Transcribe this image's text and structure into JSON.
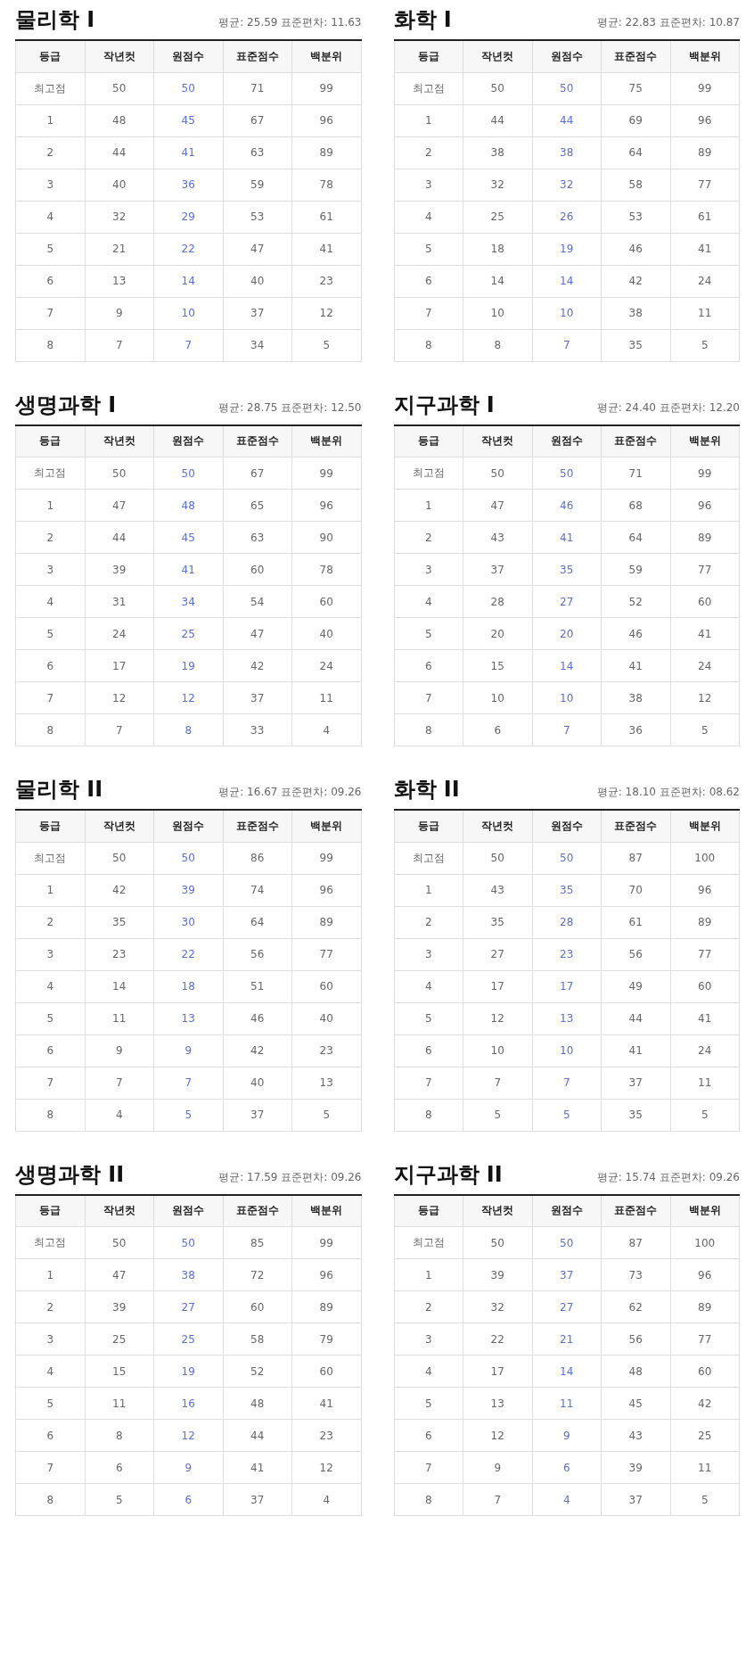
{
  "subjects": [
    {
      "title": "물리학 I",
      "stats": "평균: 25.59 표준편차: 11.63",
      "columns": [
        "등급",
        "작년컷",
        "원점수",
        "표준점수",
        "백분위"
      ],
      "rows": [
        [
          "최고점",
          "50",
          "50",
          "71",
          "99"
        ],
        [
          "1",
          "48",
          "45",
          "67",
          "96"
        ],
        [
          "2",
          "44",
          "41",
          "63",
          "89"
        ],
        [
          "3",
          "40",
          "36",
          "59",
          "78"
        ],
        [
          "4",
          "32",
          "29",
          "53",
          "61"
        ],
        [
          "5",
          "21",
          "22",
          "47",
          "41"
        ],
        [
          "6",
          "13",
          "14",
          "40",
          "23"
        ],
        [
          "7",
          "9",
          "10",
          "37",
          "12"
        ],
        [
          "8",
          "7",
          "7",
          "34",
          "5"
        ]
      ]
    },
    {
      "title": "화학 I",
      "stats": "평균: 22.83 표준편차: 10.87",
      "columns": [
        "등급",
        "작년컷",
        "원점수",
        "표준점수",
        "백분위"
      ],
      "rows": [
        [
          "최고점",
          "50",
          "50",
          "75",
          "99"
        ],
        [
          "1",
          "44",
          "44",
          "69",
          "96"
        ],
        [
          "2",
          "38",
          "38",
          "64",
          "89"
        ],
        [
          "3",
          "32",
          "32",
          "58",
          "77"
        ],
        [
          "4",
          "25",
          "26",
          "53",
          "61"
        ],
        [
          "5",
          "18",
          "19",
          "46",
          "41"
        ],
        [
          "6",
          "14",
          "14",
          "42",
          "24"
        ],
        [
          "7",
          "10",
          "10",
          "38",
          "11"
        ],
        [
          "8",
          "8",
          "7",
          "35",
          "5"
        ]
      ]
    },
    {
      "title": "생명과학 I",
      "stats": "평균: 28.75 표준편차: 12.50",
      "columns": [
        "등급",
        "작년컷",
        "원점수",
        "표준점수",
        "백분위"
      ],
      "rows": [
        [
          "최고점",
          "50",
          "50",
          "67",
          "99"
        ],
        [
          "1",
          "47",
          "48",
          "65",
          "96"
        ],
        [
          "2",
          "44",
          "45",
          "63",
          "90"
        ],
        [
          "3",
          "39",
          "41",
          "60",
          "78"
        ],
        [
          "4",
          "31",
          "34",
          "54",
          "60"
        ],
        [
          "5",
          "24",
          "25",
          "47",
          "40"
        ],
        [
          "6",
          "17",
          "19",
          "42",
          "24"
        ],
        [
          "7",
          "12",
          "12",
          "37",
          "11"
        ],
        [
          "8",
          "7",
          "8",
          "33",
          "4"
        ]
      ]
    },
    {
      "title": "지구과학 I",
      "stats": "평균: 24.40 표준편차: 12.20",
      "columns": [
        "등급",
        "작년컷",
        "원점수",
        "표준점수",
        "백분위"
      ],
      "rows": [
        [
          "최고점",
          "50",
          "50",
          "71",
          "99"
        ],
        [
          "1",
          "47",
          "46",
          "68",
          "96"
        ],
        [
          "2",
          "43",
          "41",
          "64",
          "89"
        ],
        [
          "3",
          "37",
          "35",
          "59",
          "77"
        ],
        [
          "4",
          "28",
          "27",
          "52",
          "60"
        ],
        [
          "5",
          "20",
          "20",
          "46",
          "41"
        ],
        [
          "6",
          "15",
          "14",
          "41",
          "24"
        ],
        [
          "7",
          "10",
          "10",
          "38",
          "12"
        ],
        [
          "8",
          "6",
          "7",
          "36",
          "5"
        ]
      ]
    },
    {
      "title": "물리학 II",
      "stats": "평균: 16.67 표준편차: 09.26",
      "columns": [
        "등급",
        "작년컷",
        "원점수",
        "표준점수",
        "백분위"
      ],
      "rows": [
        [
          "최고점",
          "50",
          "50",
          "86",
          "99"
        ],
        [
          "1",
          "42",
          "39",
          "74",
          "96"
        ],
        [
          "2",
          "35",
          "30",
          "64",
          "89"
        ],
        [
          "3",
          "23",
          "22",
          "56",
          "77"
        ],
        [
          "4",
          "14",
          "18",
          "51",
          "60"
        ],
        [
          "5",
          "11",
          "13",
          "46",
          "40"
        ],
        [
          "6",
          "9",
          "9",
          "42",
          "23"
        ],
        [
          "7",
          "7",
          "7",
          "40",
          "13"
        ],
        [
          "8",
          "4",
          "5",
          "37",
          "5"
        ]
      ]
    },
    {
      "title": "화학 II",
      "stats": "평균: 18.10 표준편차: 08.62",
      "columns": [
        "등급",
        "작년컷",
        "원점수",
        "표준점수",
        "백분위"
      ],
      "rows": [
        [
          "최고점",
          "50",
          "50",
          "87",
          "100"
        ],
        [
          "1",
          "43",
          "35",
          "70",
          "96"
        ],
        [
          "2",
          "35",
          "28",
          "61",
          "89"
        ],
        [
          "3",
          "27",
          "23",
          "56",
          "77"
        ],
        [
          "4",
          "17",
          "17",
          "49",
          "60"
        ],
        [
          "5",
          "12",
          "13",
          "44",
          "41"
        ],
        [
          "6",
          "10",
          "10",
          "41",
          "24"
        ],
        [
          "7",
          "7",
          "7",
          "37",
          "11"
        ],
        [
          "8",
          "5",
          "5",
          "35",
          "5"
        ]
      ]
    },
    {
      "title": "생명과학 II",
      "stats": "평균: 17.59 표준편차: 09.26",
      "columns": [
        "등급",
        "작년컷",
        "원점수",
        "표준점수",
        "백분위"
      ],
      "rows": [
        [
          "최고점",
          "50",
          "50",
          "85",
          "99"
        ],
        [
          "1",
          "47",
          "38",
          "72",
          "96"
        ],
        [
          "2",
          "39",
          "27",
          "60",
          "89"
        ],
        [
          "3",
          "25",
          "25",
          "58",
          "79"
        ],
        [
          "4",
          "15",
          "19",
          "52",
          "60"
        ],
        [
          "5",
          "11",
          "16",
          "48",
          "41"
        ],
        [
          "6",
          "8",
          "12",
          "44",
          "23"
        ],
        [
          "7",
          "6",
          "9",
          "41",
          "12"
        ],
        [
          "8",
          "5",
          "6",
          "37",
          "4"
        ]
      ]
    },
    {
      "title": "지구과학 II",
      "stats": "평균: 15.74 표준편차: 09.26",
      "columns": [
        "등급",
        "작년컷",
        "원점수",
        "표준점수",
        "백분위"
      ],
      "rows": [
        [
          "최고점",
          "50",
          "50",
          "87",
          "100"
        ],
        [
          "1",
          "39",
          "37",
          "73",
          "96"
        ],
        [
          "2",
          "32",
          "27",
          "62",
          "89"
        ],
        [
          "3",
          "22",
          "21",
          "56",
          "77"
        ],
        [
          "4",
          "17",
          "14",
          "48",
          "60"
        ],
        [
          "5",
          "13",
          "11",
          "45",
          "42"
        ],
        [
          "6",
          "12",
          "9",
          "43",
          "25"
        ],
        [
          "7",
          "9",
          "6",
          "39",
          "11"
        ],
        [
          "8",
          "7",
          "4",
          "37",
          "5"
        ]
      ]
    }
  ]
}
